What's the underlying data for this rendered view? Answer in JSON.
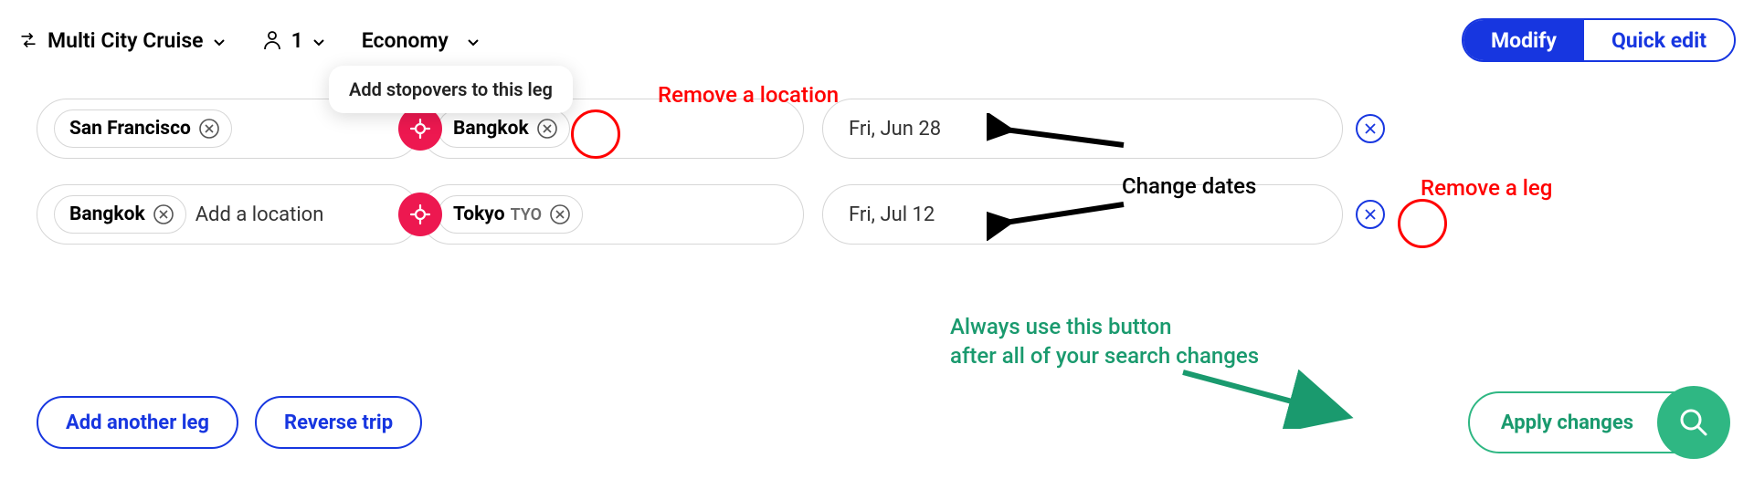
{
  "topbar": {
    "trip_type": "Multi City Cruise",
    "pax_count": "1",
    "cabin_class": "Economy",
    "segmented": {
      "modify": "Modify",
      "quick_edit": "Quick edit"
    }
  },
  "tooltip": {
    "text": "Add stopovers to this leg"
  },
  "legs": [
    {
      "from_chips": [
        {
          "label": "San Francisco",
          "sub": ""
        }
      ],
      "from_placeholder": "",
      "to_chips": [
        {
          "label": "Bangkok",
          "sub": ""
        }
      ],
      "date": "Fri, Jun 28"
    },
    {
      "from_chips": [
        {
          "label": "Bangkok",
          "sub": ""
        }
      ],
      "from_placeholder": "Add a location",
      "to_chips": [
        {
          "label": "Tokyo",
          "sub": "TYO"
        }
      ],
      "date": "Fri, Jul 12"
    }
  ],
  "buttons": {
    "add_leg": "Add another leg",
    "reverse": "Reverse trip",
    "apply": "Apply changes"
  },
  "annotations": {
    "remove_location": "Remove a location",
    "change_dates": "Change dates",
    "remove_leg": "Remove a leg",
    "apply_hint_line1": "Always use this button",
    "apply_hint_line2": "after all of your search changes"
  }
}
